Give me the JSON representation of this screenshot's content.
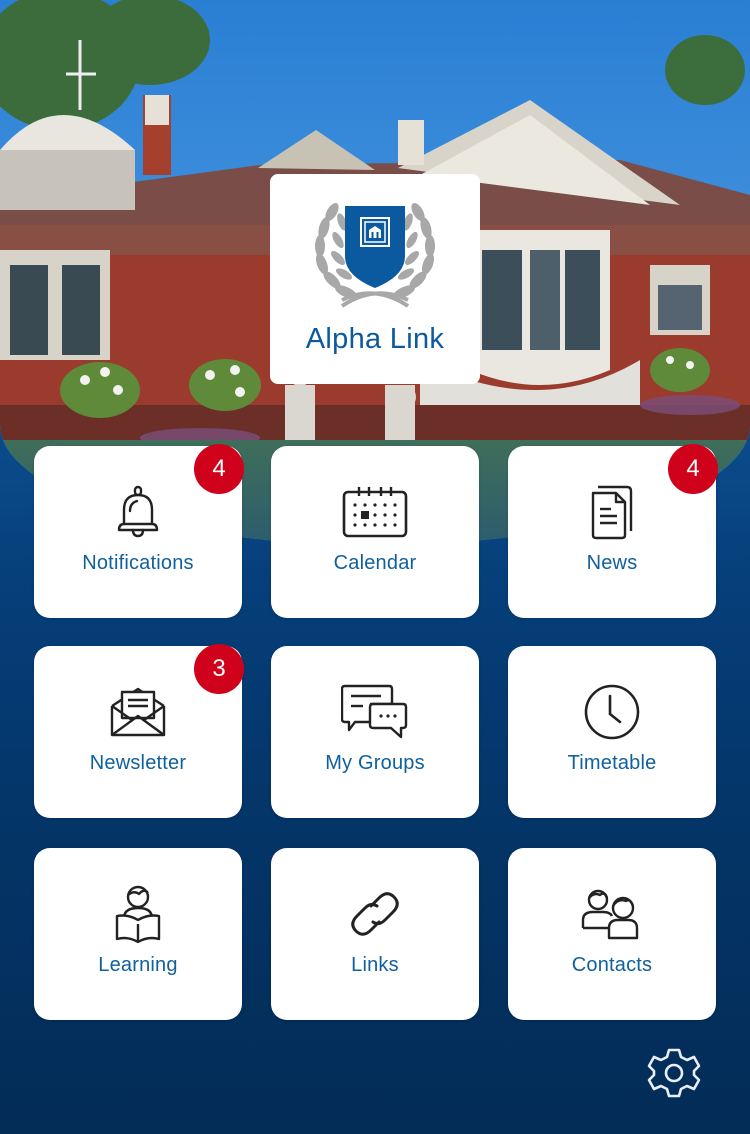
{
  "app": {
    "name": "Alpha Link",
    "brand_color": "#0b5aa0",
    "badge_color": "#d0021b",
    "background_color": "#043466"
  },
  "hero": {
    "image": "school-building-photo",
    "logo_icon": "laurel-shield-crest-icon"
  },
  "tiles": [
    {
      "label": "Notifications",
      "icon": "bell-icon",
      "badge": "4"
    },
    {
      "label": "Calendar",
      "icon": "calendar-icon",
      "badge": null
    },
    {
      "label": "News",
      "icon": "documents-icon",
      "badge": "4"
    },
    {
      "label": "Newsletter",
      "icon": "open-envelope-icon",
      "badge": "3"
    },
    {
      "label": "My Groups",
      "icon": "chat-bubbles-icon",
      "badge": null
    },
    {
      "label": "Timetable",
      "icon": "clock-icon",
      "badge": null
    },
    {
      "label": "Learning",
      "icon": "reading-student-icon",
      "badge": null
    },
    {
      "label": "Links",
      "icon": "link-chain-icon",
      "badge": null
    },
    {
      "label": "Contacts",
      "icon": "people-icon",
      "badge": null
    }
  ],
  "footer": {
    "settings_icon": "gear-icon"
  }
}
